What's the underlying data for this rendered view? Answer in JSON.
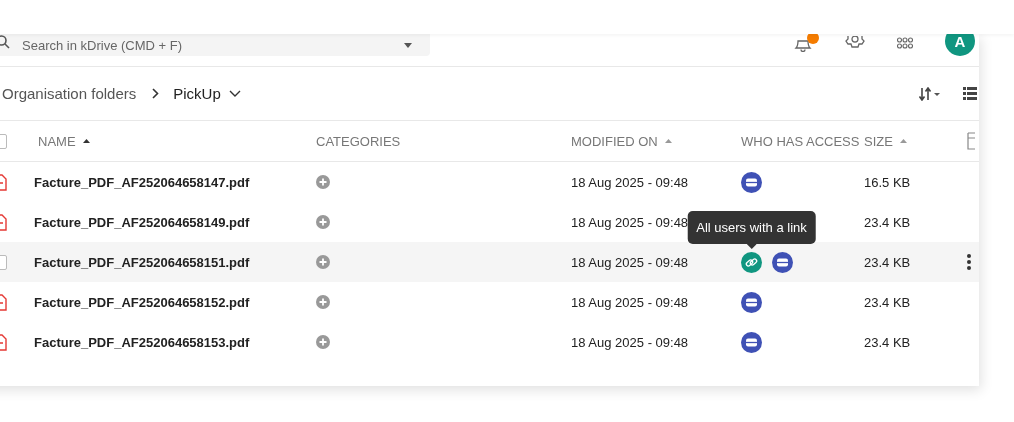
{
  "search": {
    "placeholder": "Search in kDrive (CMD + F)"
  },
  "header": {
    "notification_dot": true,
    "avatar": "A"
  },
  "breadcrumb": [
    {
      "label": "Organisation folders",
      "current": false
    },
    {
      "label": "PickUp",
      "current": true
    }
  ],
  "select_all": {
    "checked": false
  },
  "columns": [
    {
      "label": "NAME",
      "sort_indicator": true,
      "sort_active": true
    },
    {
      "label": "CATEGORIES",
      "sort_indicator": false
    },
    {
      "label": "MODIFIED ON",
      "sort_indicator": true,
      "sort_active": false
    },
    {
      "label": "WHO HAS ACCESS",
      "sort_indicator": false
    },
    {
      "label": "SIZE",
      "sort_indicator": true,
      "sort_active": false
    }
  ],
  "rows": [
    {
      "name": "Facture_PDF_AF252064658147.pdf",
      "modified": "18 Aug 2025 - 09:48",
      "access": [
        {
          "kind": "drive"
        }
      ],
      "size": "16.5 KB",
      "hovered": false
    },
    {
      "name": "Facture_PDF_AF252064658149.pdf",
      "modified": "18 Aug 2025 - 09:48",
      "size": "23.4 KB",
      "hovered": false
    },
    {
      "name": "Facture_PDF_AF252064658151.pdf",
      "modified": "18 Aug 2025 - 09:48",
      "access": [
        {
          "kind": "link",
          "tooltip": "All users with a link"
        },
        {
          "kind": "drive"
        }
      ],
      "size": "23.4 KB",
      "hovered": true
    },
    {
      "name": "Facture_PDF_AF252064658152.pdf",
      "modified": "18 Aug 2025 - 09:48",
      "access": [
        {
          "kind": "drive"
        }
      ],
      "size": "23.4 KB",
      "hovered": false
    },
    {
      "name": "Facture_PDF_AF252064658153.pdf",
      "modified": "18 Aug 2025 - 09:48",
      "access": [
        {
          "kind": "drive"
        }
      ],
      "size": "23.4 KB",
      "hovered": false
    }
  ]
}
